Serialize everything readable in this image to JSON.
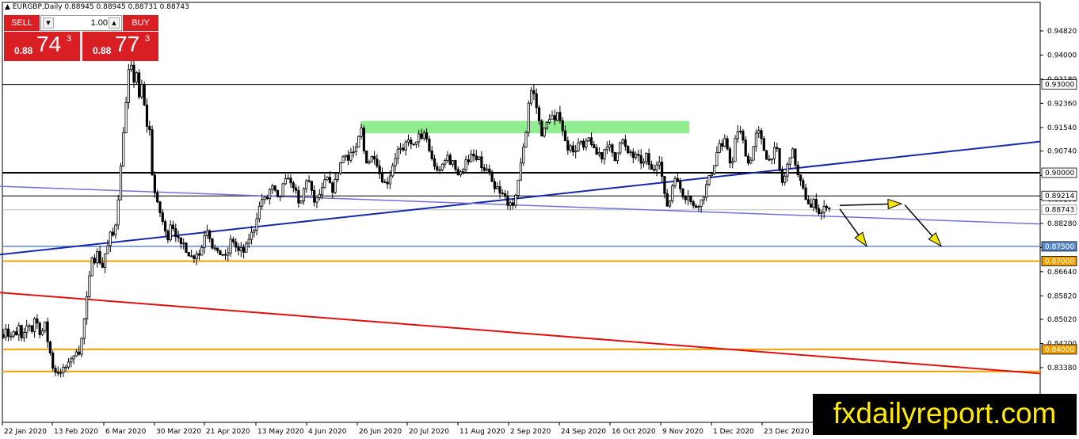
{
  "header": {
    "symbol_label": "EURGBP,Daily",
    "ohlc": "0.88945 0.88945 0.88731 0.88743"
  },
  "trade_panel": {
    "sell_label": "SELL",
    "buy_label": "BUY",
    "lot_value": "1.00",
    "sell_price": {
      "prefix": "0.88",
      "big": "74",
      "sup": "3"
    },
    "buy_price": {
      "prefix": "0.88",
      "big": "77",
      "sup": "3"
    }
  },
  "brand": "fxdailyreport.com",
  "chart_data": {
    "type": "candlestick",
    "title": "EURGBP,Daily",
    "ylim": [
      0.8152,
      0.9579
    ],
    "yticks": [
      "0.94820",
      "0.94000",
      "0.93180",
      "0.92360",
      "0.91540",
      "0.90740",
      "0.89910",
      "0.89100",
      "0.88280",
      "0.87460",
      "0.86640",
      "0.85820",
      "0.85020",
      "0.84200",
      "0.83380"
    ],
    "xticks": [
      "22 Jan 2020",
      "13 Feb 2020",
      "6 Mar 2020",
      "30 Mar 2020",
      "21 Apr 2020",
      "13 May 2020",
      "4 Jun 2020",
      "26 Jun 2020",
      "20 Jul 2020",
      "11 Aug 2020",
      "2 Sep 2020",
      "24 Sep 2020",
      "16 Oct 2020",
      "9 Nov 2020",
      "1 Dec 2020",
      "23 Dec 2020"
    ],
    "price_path": [
      [
        0,
        0.85
      ],
      [
        4,
        0.845
      ],
      [
        8,
        0.848
      ],
      [
        12,
        0.843
      ],
      [
        16,
        0.846
      ],
      [
        20,
        0.844
      ],
      [
        24,
        0.848
      ],
      [
        28,
        0.842
      ],
      [
        32,
        0.847
      ],
      [
        36,
        0.849
      ],
      [
        40,
        0.846
      ],
      [
        44,
        0.851
      ],
      [
        48,
        0.848
      ],
      [
        52,
        0.844
      ],
      [
        56,
        0.85
      ],
      [
        60,
        0.843
      ],
      [
        64,
        0.838
      ],
      [
        68,
        0.832
      ],
      [
        72,
        0.833
      ],
      [
        76,
        0.831
      ],
      [
        80,
        0.834
      ],
      [
        84,
        0.833
      ],
      [
        88,
        0.838
      ],
      [
        92,
        0.836
      ],
      [
        96,
        0.84
      ],
      [
        100,
        0.839
      ],
      [
        104,
        0.845
      ],
      [
        108,
        0.854
      ],
      [
        112,
        0.862
      ],
      [
        116,
        0.872
      ],
      [
        120,
        0.87
      ],
      [
        124,
        0.874
      ],
      [
        128,
        0.866
      ],
      [
        132,
        0.872
      ],
      [
        136,
        0.875
      ],
      [
        140,
        0.88
      ],
      [
        144,
        0.878
      ],
      [
        148,
        0.888
      ],
      [
        152,
        0.9
      ],
      [
        156,
        0.915
      ],
      [
        160,
        0.926
      ],
      [
        164,
        0.94
      ],
      [
        168,
        0.93
      ],
      [
        172,
        0.935
      ],
      [
        176,
        0.924
      ],
      [
        180,
        0.932
      ],
      [
        184,
        0.915
      ],
      [
        188,
        0.918
      ],
      [
        192,
        0.9
      ],
      [
        196,
        0.892
      ],
      [
        200,
        0.888
      ],
      [
        204,
        0.885
      ],
      [
        208,
        0.88
      ],
      [
        212,
        0.878
      ],
      [
        216,
        0.884
      ],
      [
        220,
        0.88
      ],
      [
        224,
        0.878
      ],
      [
        228,
        0.875
      ],
      [
        232,
        0.876
      ],
      [
        236,
        0.873
      ],
      [
        240,
        0.872
      ],
      [
        244,
        0.871
      ],
      [
        248,
        0.873
      ],
      [
        252,
        0.872
      ],
      [
        256,
        0.876
      ],
      [
        260,
        0.882
      ],
      [
        264,
        0.879
      ],
      [
        268,
        0.875
      ],
      [
        272,
        0.874
      ],
      [
        276,
        0.872
      ],
      [
        280,
        0.873
      ],
      [
        284,
        0.871
      ],
      [
        288,
        0.873
      ],
      [
        292,
        0.878
      ],
      [
        296,
        0.876
      ],
      [
        300,
        0.873
      ],
      [
        304,
        0.874
      ],
      [
        308,
        0.873
      ],
      [
        312,
        0.876
      ],
      [
        316,
        0.879
      ],
      [
        320,
        0.88
      ],
      [
        324,
        0.885
      ],
      [
        328,
        0.889
      ],
      [
        332,
        0.892
      ],
      [
        336,
        0.89
      ],
      [
        340,
        0.894
      ],
      [
        344,
        0.895
      ],
      [
        348,
        0.893
      ],
      [
        352,
        0.89
      ],
      [
        356,
        0.895
      ],
      [
        360,
        0.897
      ],
      [
        364,
        0.899
      ],
      [
        368,
        0.895
      ],
      [
        372,
        0.896
      ],
      [
        376,
        0.889
      ],
      [
        380,
        0.89
      ],
      [
        384,
        0.895
      ],
      [
        388,
        0.899
      ],
      [
        392,
        0.895
      ],
      [
        396,
        0.89
      ],
      [
        400,
        0.891
      ],
      [
        404,
        0.893
      ],
      [
        408,
        0.895
      ],
      [
        412,
        0.899
      ],
      [
        416,
        0.896
      ],
      [
        420,
        0.894
      ],
      [
        424,
        0.898
      ],
      [
        428,
        0.902
      ],
      [
        432,
        0.905
      ],
      [
        436,
        0.907
      ],
      [
        440,
        0.904
      ],
      [
        444,
        0.908
      ],
      [
        448,
        0.906
      ],
      [
        452,
        0.911
      ],
      [
        456,
        0.915
      ],
      [
        460,
        0.906
      ],
      [
        464,
        0.903
      ],
      [
        468,
        0.905
      ],
      [
        472,
        0.906
      ],
      [
        476,
        0.903
      ],
      [
        480,
        0.899
      ],
      [
        484,
        0.897
      ],
      [
        488,
        0.896
      ],
      [
        492,
        0.899
      ],
      [
        496,
        0.903
      ],
      [
        500,
        0.906
      ],
      [
        504,
        0.909
      ],
      [
        508,
        0.906
      ],
      [
        512,
        0.91
      ],
      [
        516,
        0.912
      ],
      [
        520,
        0.908
      ],
      [
        524,
        0.91
      ],
      [
        528,
        0.913
      ],
      [
        532,
        0.911
      ],
      [
        536,
        0.914
      ],
      [
        540,
        0.91
      ],
      [
        544,
        0.905
      ],
      [
        548,
        0.903
      ],
      [
        552,
        0.9
      ],
      [
        556,
        0.901
      ],
      [
        560,
        0.904
      ],
      [
        564,
        0.906
      ],
      [
        568,
        0.903
      ],
      [
        572,
        0.905
      ],
      [
        576,
        0.9
      ],
      [
        580,
        0.899
      ],
      [
        584,
        0.901
      ],
      [
        588,
        0.905
      ],
      [
        592,
        0.903
      ],
      [
        596,
        0.907
      ],
      [
        600,
        0.904
      ],
      [
        604,
        0.905
      ],
      [
        608,
        0.902
      ],
      [
        612,
        0.9
      ],
      [
        616,
        0.902
      ],
      [
        620,
        0.897
      ],
      [
        624,
        0.894
      ],
      [
        628,
        0.895
      ],
      [
        632,
        0.892
      ],
      [
        636,
        0.893
      ],
      [
        640,
        0.89
      ],
      [
        644,
        0.889
      ],
      [
        648,
        0.888
      ],
      [
        652,
        0.895
      ],
      [
        656,
        0.9
      ],
      [
        660,
        0.908
      ],
      [
        664,
        0.914
      ],
      [
        668,
        0.926
      ],
      [
        672,
        0.929
      ],
      [
        676,
        0.924
      ],
      [
        680,
        0.918
      ],
      [
        684,
        0.913
      ],
      [
        688,
        0.915
      ],
      [
        692,
        0.918
      ],
      [
        696,
        0.92
      ],
      [
        700,
        0.917
      ],
      [
        704,
        0.92
      ],
      [
        708,
        0.918
      ],
      [
        712,
        0.912
      ],
      [
        716,
        0.908
      ],
      [
        720,
        0.91
      ],
      [
        724,
        0.906
      ],
      [
        728,
        0.909
      ],
      [
        732,
        0.911
      ],
      [
        736,
        0.908
      ],
      [
        740,
        0.91
      ],
      [
        744,
        0.912
      ],
      [
        748,
        0.909
      ],
      [
        752,
        0.906
      ],
      [
        756,
        0.907
      ],
      [
        760,
        0.905
      ],
      [
        764,
        0.909
      ],
      [
        768,
        0.91
      ],
      [
        772,
        0.907
      ],
      [
        776,
        0.904
      ],
      [
        780,
        0.908
      ],
      [
        784,
        0.912
      ],
      [
        788,
        0.91
      ],
      [
        792,
        0.906
      ],
      [
        796,
        0.907
      ],
      [
        800,
        0.905
      ],
      [
        804,
        0.906
      ],
      [
        808,
        0.904
      ],
      [
        812,
        0.903
      ],
      [
        816,
        0.906
      ],
      [
        820,
        0.902
      ],
      [
        824,
        0.9
      ],
      [
        828,
        0.903
      ],
      [
        832,
        0.905
      ],
      [
        836,
        0.898
      ],
      [
        840,
        0.89
      ],
      [
        844,
        0.888
      ],
      [
        848,
        0.895
      ],
      [
        852,
        0.899
      ],
      [
        856,
        0.896
      ],
      [
        860,
        0.894
      ],
      [
        864,
        0.891
      ],
      [
        868,
        0.893
      ],
      [
        872,
        0.89
      ],
      [
        876,
        0.888
      ],
      [
        880,
        0.889
      ],
      [
        884,
        0.89
      ],
      [
        888,
        0.892
      ],
      [
        892,
        0.896
      ],
      [
        896,
        0.899
      ],
      [
        900,
        0.901
      ],
      [
        904,
        0.906
      ],
      [
        908,
        0.91
      ],
      [
        912,
        0.908
      ],
      [
        916,
        0.912
      ],
      [
        920,
        0.905
      ],
      [
        924,
        0.902
      ],
      [
        928,
        0.911
      ],
      [
        932,
        0.915
      ],
      [
        936,
        0.913
      ],
      [
        940,
        0.908
      ],
      [
        944,
        0.903
      ],
      [
        948,
        0.905
      ],
      [
        952,
        0.91
      ],
      [
        956,
        0.915
      ],
      [
        960,
        0.912
      ],
      [
        964,
        0.908
      ],
      [
        968,
        0.905
      ],
      [
        972,
        0.904
      ],
      [
        976,
        0.907
      ],
      [
        980,
        0.909
      ],
      [
        984,
        0.901
      ],
      [
        988,
        0.896
      ],
      [
        992,
        0.9
      ],
      [
        996,
        0.905
      ],
      [
        1000,
        0.908
      ],
      [
        1004,
        0.903
      ],
      [
        1008,
        0.898
      ],
      [
        1012,
        0.896
      ],
      [
        1016,
        0.892
      ],
      [
        1020,
        0.89
      ],
      [
        1024,
        0.888
      ],
      [
        1028,
        0.891
      ],
      [
        1032,
        0.887
      ],
      [
        1036,
        0.886
      ],
      [
        1040,
        0.888
      ],
      [
        1044,
        0.889
      ],
      [
        1048,
        0.8874
      ]
    ],
    "annotations": {
      "hlines": [
        {
          "price": 0.93,
          "label": "0.93000",
          "color": "#000000",
          "width": 1
        },
        {
          "price": 0.9,
          "label": "0.90000",
          "color": "#000000",
          "width": 2
        },
        {
          "price": 0.89214,
          "label": "0.89214",
          "color": "#000000",
          "width": 1
        },
        {
          "price": 0.88743,
          "label": "0.88743",
          "color": "#bbbbbb",
          "width": 1
        },
        {
          "price": 0.875,
          "label": "0.87500",
          "color": "#5b88c8",
          "width": 1.5
        },
        {
          "price": 0.87,
          "label": "0.87000",
          "color": "#f0a000",
          "width": 2
        },
        {
          "price": 0.84,
          "label": "0.84000",
          "color": "#f0a000",
          "width": 2
        },
        {
          "price": 0.8325,
          "label": "",
          "color": "#f0a000",
          "width": 2
        }
      ],
      "trendlines": [
        {
          "x1": 0,
          "p1": 0.8722,
          "x2": 1313,
          "p2": 0.9106,
          "color": "#1428a8",
          "width": 2
        },
        {
          "x1": 0,
          "p1": 0.8954,
          "x2": 1313,
          "p2": 0.8826,
          "color": "#7670d8",
          "width": 1.5
        },
        {
          "x1": 0,
          "p1": 0.8593,
          "x2": 1313,
          "p2": 0.8318,
          "color": "#e01010",
          "width": 2
        }
      ],
      "zone": {
        "x1": 455,
        "x2": 870,
        "p1": 0.9176,
        "p2": 0.9134,
        "color": "#90ee90"
      },
      "arrows": [
        {
          "x1": 1060,
          "p1": 0.8877,
          "x2": 1094,
          "p2": 0.8751
        },
        {
          "x1": 1060,
          "p1": 0.8889,
          "x2": 1138,
          "p2": 0.8895
        },
        {
          "x1": 1142,
          "p1": 0.8891,
          "x2": 1188,
          "p2": 0.8751
        }
      ],
      "arrow_color": "#f5e60a"
    }
  }
}
